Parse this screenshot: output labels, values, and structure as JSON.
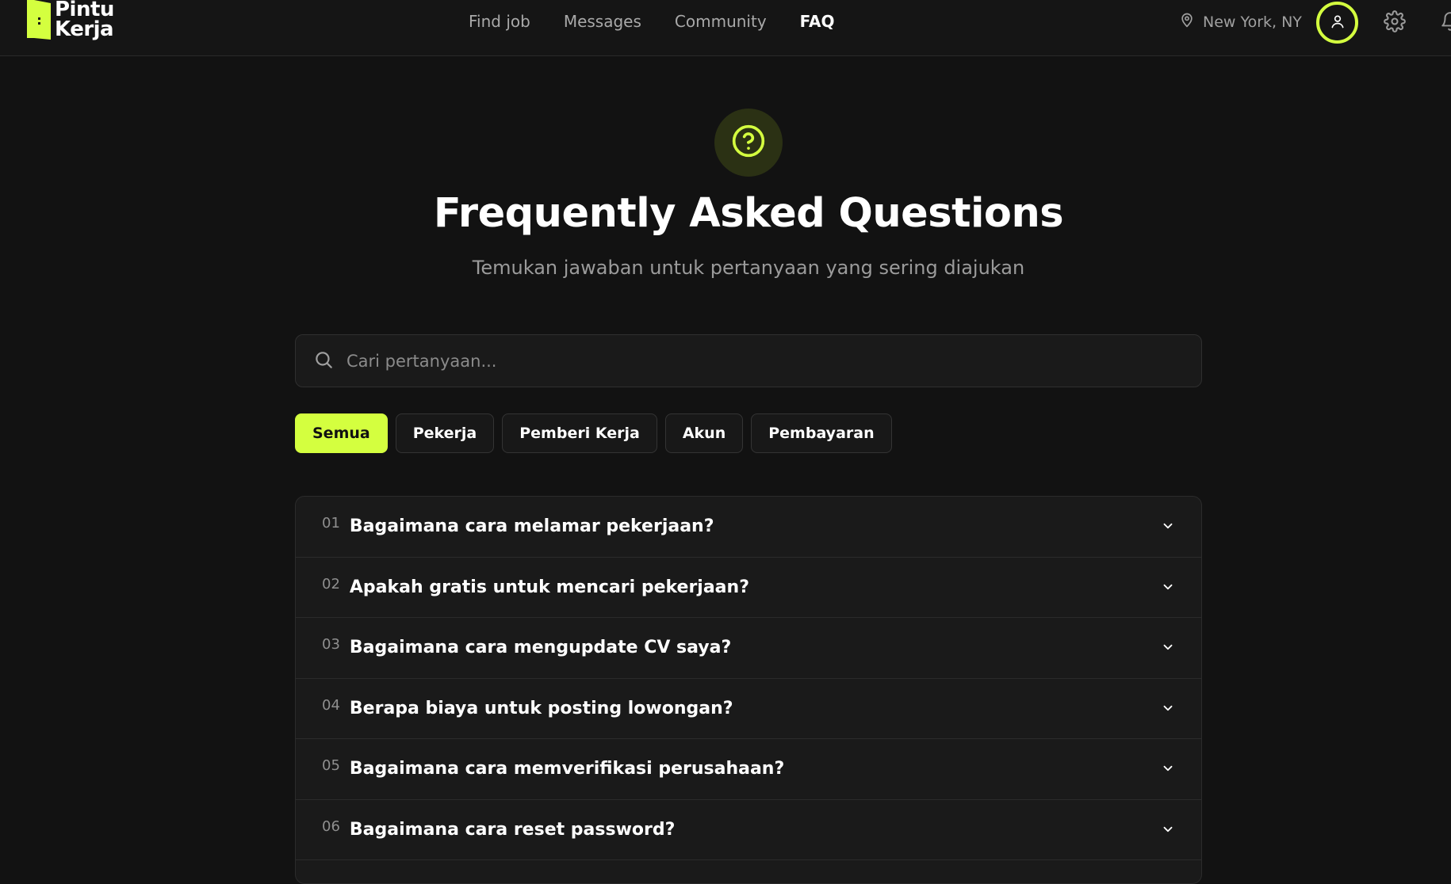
{
  "brand": {
    "line1": "Pintu",
    "line2": "Kerja",
    "accent": "#d4ff3f"
  },
  "nav": {
    "links": [
      {
        "label": "Find job",
        "active": false
      },
      {
        "label": "Messages",
        "active": false
      },
      {
        "label": "Community",
        "active": false
      },
      {
        "label": "FAQ",
        "active": true
      }
    ],
    "location": "New York, NY",
    "icons": [
      "map-pin-icon",
      "user-icon",
      "gear-icon",
      "bell-icon"
    ]
  },
  "hero": {
    "icon": "question-circle-icon",
    "title": "Frequently Asked Questions",
    "subtitle": "Temukan jawaban untuk pertanyaan yang sering diajukan"
  },
  "search": {
    "placeholder": "Cari pertanyaan...",
    "value": ""
  },
  "filters": [
    {
      "label": "Semua",
      "active": true
    },
    {
      "label": "Pekerja",
      "active": false
    },
    {
      "label": "Pemberi Kerja",
      "active": false
    },
    {
      "label": "Akun",
      "active": false
    },
    {
      "label": "Pembayaran",
      "active": false
    }
  ],
  "faqs": [
    {
      "num": "01",
      "question": "Bagaimana cara melamar pekerjaan?"
    },
    {
      "num": "02",
      "question": "Apakah gratis untuk mencari pekerjaan?"
    },
    {
      "num": "03",
      "question": "Bagaimana cara mengupdate CV saya?"
    },
    {
      "num": "04",
      "question": "Berapa biaya untuk posting lowongan?"
    },
    {
      "num": "05",
      "question": "Bagaimana cara memverifikasi perusahaan?"
    },
    {
      "num": "06",
      "question": "Bagaimana cara reset password?"
    }
  ]
}
